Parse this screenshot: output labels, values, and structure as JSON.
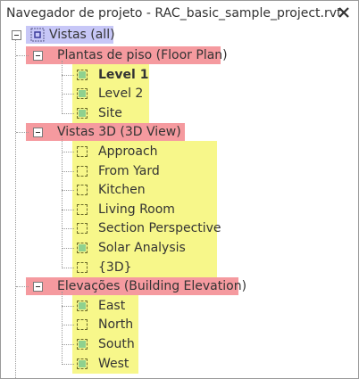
{
  "window": {
    "title": "Navegador de projeto - RAC_basic_sample_project.rvt",
    "close_glyph": "✕"
  },
  "tree": {
    "root": {
      "label": "Vistas (all)",
      "icon": "views-icon"
    },
    "groups": [
      {
        "label": "Plantas de piso (Floor Plan)",
        "items": [
          {
            "label": "Level 1",
            "bold": true,
            "icon": "green"
          },
          {
            "label": "Level 2",
            "bold": false,
            "icon": "green"
          },
          {
            "label": "Site",
            "bold": false,
            "icon": "green"
          }
        ]
      },
      {
        "label": "Vistas 3D (3D View)",
        "items": [
          {
            "label": "Approach",
            "bold": false,
            "icon": "empty"
          },
          {
            "label": "From Yard",
            "bold": false,
            "icon": "empty"
          },
          {
            "label": "Kitchen",
            "bold": false,
            "icon": "empty"
          },
          {
            "label": "Living Room",
            "bold": false,
            "icon": "empty"
          },
          {
            "label": "Section Perspective",
            "bold": false,
            "icon": "empty"
          },
          {
            "label": "Solar Analysis",
            "bold": false,
            "icon": "green"
          },
          {
            "label": "{3D}",
            "bold": false,
            "icon": "empty"
          }
        ]
      },
      {
        "label": "Elevações (Building Elevation)",
        "items": [
          {
            "label": "East",
            "bold": false,
            "icon": "green"
          },
          {
            "label": "North",
            "bold": false,
            "icon": "empty"
          },
          {
            "label": "South",
            "bold": false,
            "icon": "green"
          },
          {
            "label": "West",
            "bold": false,
            "icon": "green"
          }
        ]
      }
    ]
  },
  "colors": {
    "group_highlight": "#f59a9f",
    "item_highlight": "#f7f78a",
    "root_highlight": "#c7c7f7",
    "view_icon_fill": "#8fd18f"
  }
}
